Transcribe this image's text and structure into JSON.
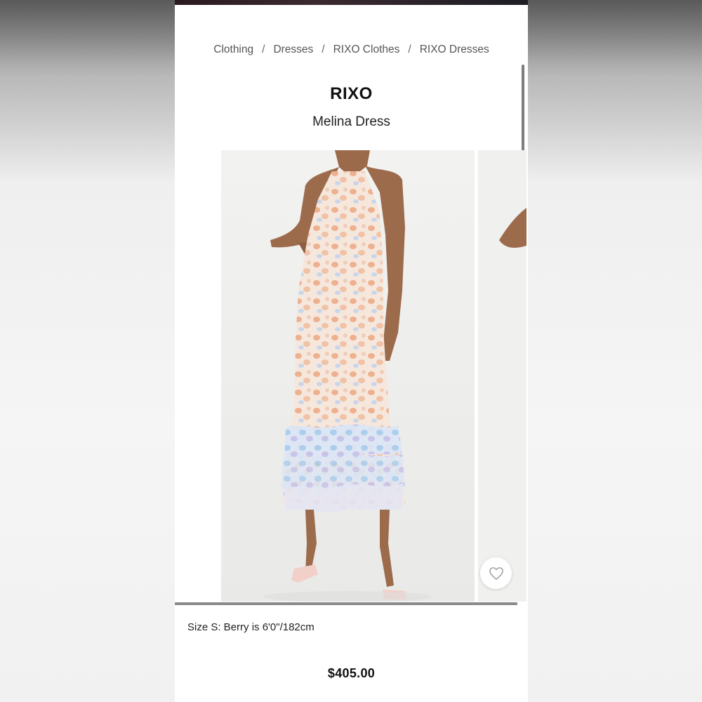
{
  "breadcrumb": {
    "items": [
      "Clothing",
      "Dresses",
      "RIXO Clothes",
      "RIXO Dresses"
    ],
    "separator": "/"
  },
  "product": {
    "brand": "RIXO",
    "name": "Melina Dress",
    "size_info": "Size S: Berry is 6'0\"/182cm",
    "price": "$405.00"
  },
  "gallery": {
    "images": [
      {
        "alt": "model-front-view"
      },
      {
        "alt": "model-side-view"
      }
    ]
  },
  "icons": {
    "wishlist": "heart-icon"
  }
}
